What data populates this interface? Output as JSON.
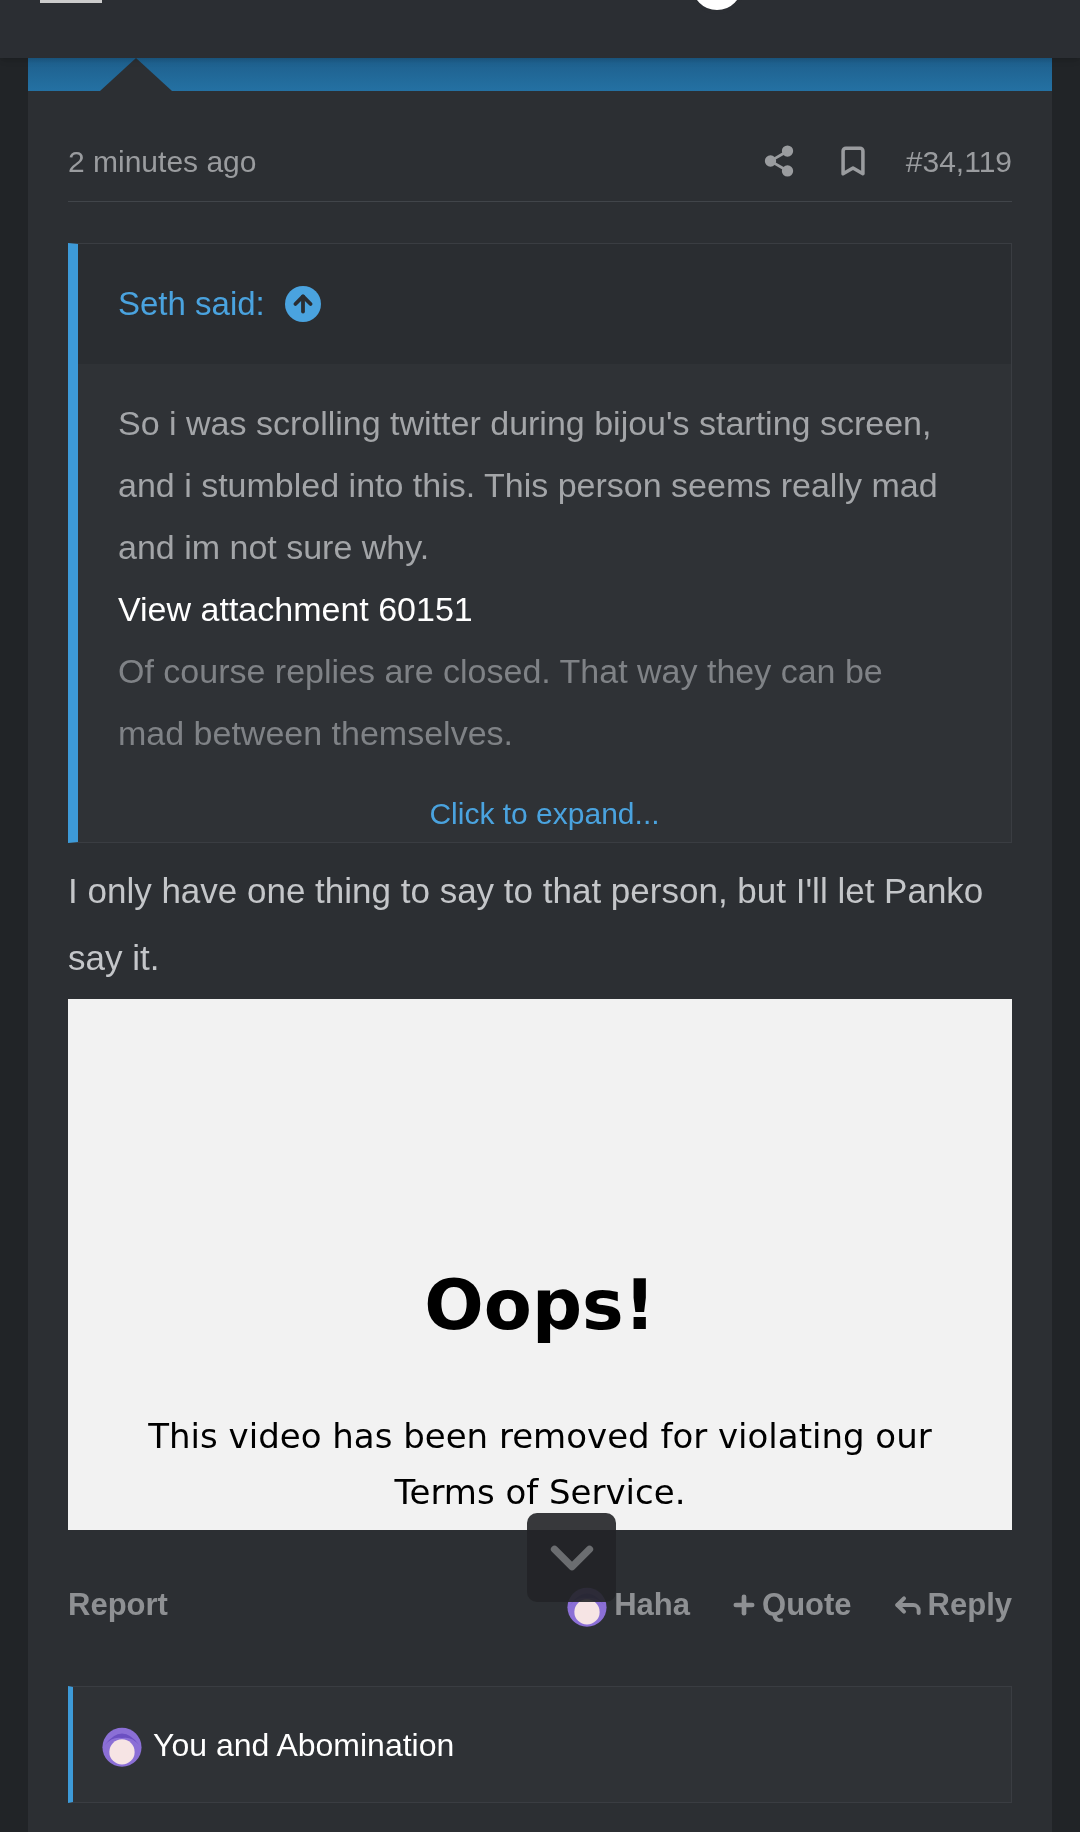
{
  "post": {
    "time": "2 minutes ago",
    "number": "#34,119",
    "quote": {
      "author": "Seth said:",
      "paragraphs": [
        "So i was scrolling twitter during bijou's starting screen, and i stumbled into this. This person seems really mad and im not sure why."
      ],
      "attachment": "View attachment 60151",
      "faded": "Of course replies are closed. That way they can be mad between themselves.",
      "expand": "Click to expand..."
    },
    "body": "I only have one thing to say to that person, but I'll let Panko say it.",
    "embed": {
      "title": "Oops!",
      "message": "This video has been removed for violating our Terms of Service."
    },
    "actions": [
      {
        "kind": "report",
        "label": "Report"
      },
      {
        "kind": "reaction",
        "label": "Haha"
      },
      {
        "kind": "quote",
        "label": "Quote"
      },
      {
        "kind": "reply",
        "label": "Reply"
      }
    ],
    "reactions": {
      "text": "You and Abomination"
    }
  }
}
